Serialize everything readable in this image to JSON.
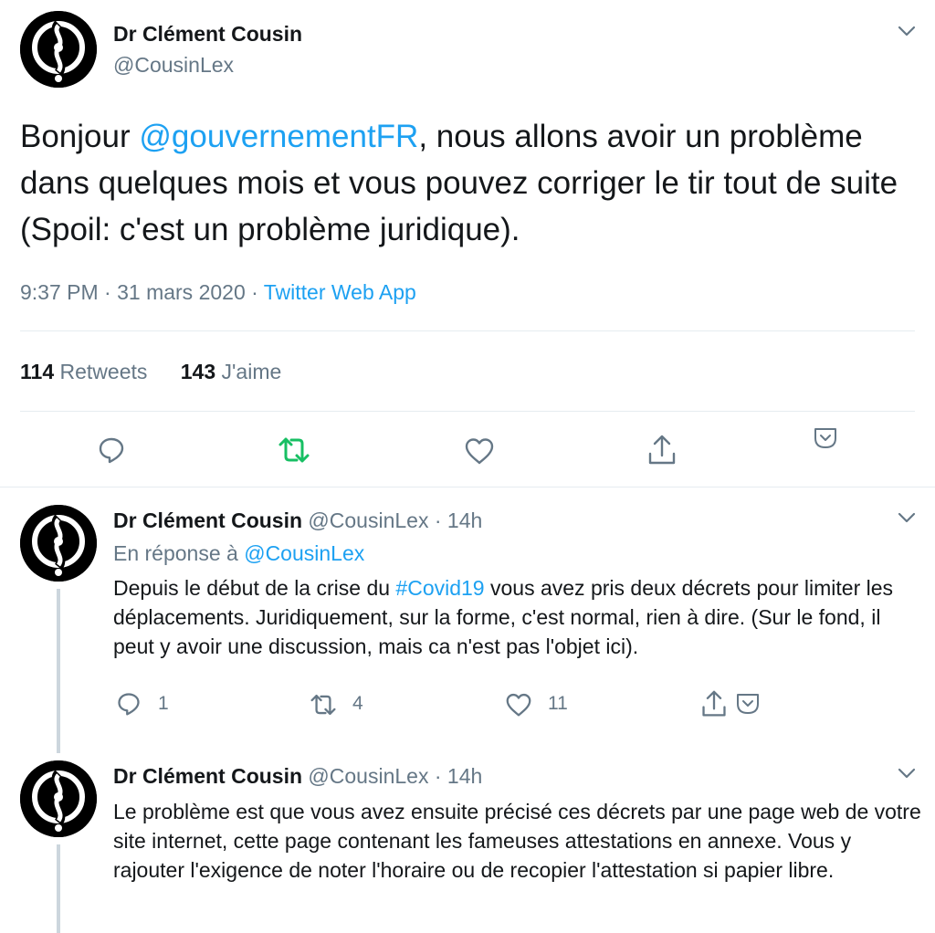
{
  "main_tweet": {
    "author_name": "Dr Clément Cousin",
    "author_handle": "@CousinLex",
    "text_before": "Bonjour ",
    "mention": "@gouvernementFR",
    "text_after": ", nous allons avoir un problème dans quelques mois et vous pouvez corriger le tir tout de suite (Spoil: c'est un problème juridique).",
    "time_date": "9:37 PM · 31 mars 2020 · ",
    "source": "Twitter Web App",
    "retweets_count": "114",
    "retweets_label": "Retweets",
    "likes_count": "143",
    "likes_label": "J'aime"
  },
  "replies": [
    {
      "author_name": "Dr Clément Cousin",
      "author_handle": "@CousinLex",
      "dot": "·",
      "time": "14h",
      "reply_to_label": "En réponse à ",
      "reply_to_handle": "@CousinLex",
      "text_before": "Depuis le début de la crise du ",
      "hashtag": "#Covid19",
      "text_after": " vous avez pris deux décrets pour limiter les déplacements. Juridiquement, sur la forme, c'est normal, rien à dire. (Sur le fond, il peut y avoir une discussion, mais ca n'est pas l'objet ici).",
      "reply_count": "1",
      "retweet_count": "4",
      "like_count": "11"
    },
    {
      "author_name": "Dr Clément Cousin",
      "author_handle": "@CousinLex",
      "dot": "·",
      "time": "14h",
      "text": "Le problème est que vous avez ensuite précisé ces décrets par une page web de votre site internet, cette page contenant les fameuses attestations en annexe. Vous y rajouter l'exigence de noter l'horaire ou de recopier l'attestation si papier libre."
    }
  ],
  "icons": {
    "reply": "reply-icon",
    "retweet": "retweet-icon",
    "like": "heart-icon",
    "share": "share-icon",
    "more": "chevron-down-icon",
    "save": "save-icon"
  },
  "colors": {
    "text": "#14171a",
    "secondary": "#657786",
    "link": "#1da1f2",
    "retweet_active": "#17bf63",
    "divider": "#e6ecf0",
    "thread_line": "#ccd6dd"
  }
}
